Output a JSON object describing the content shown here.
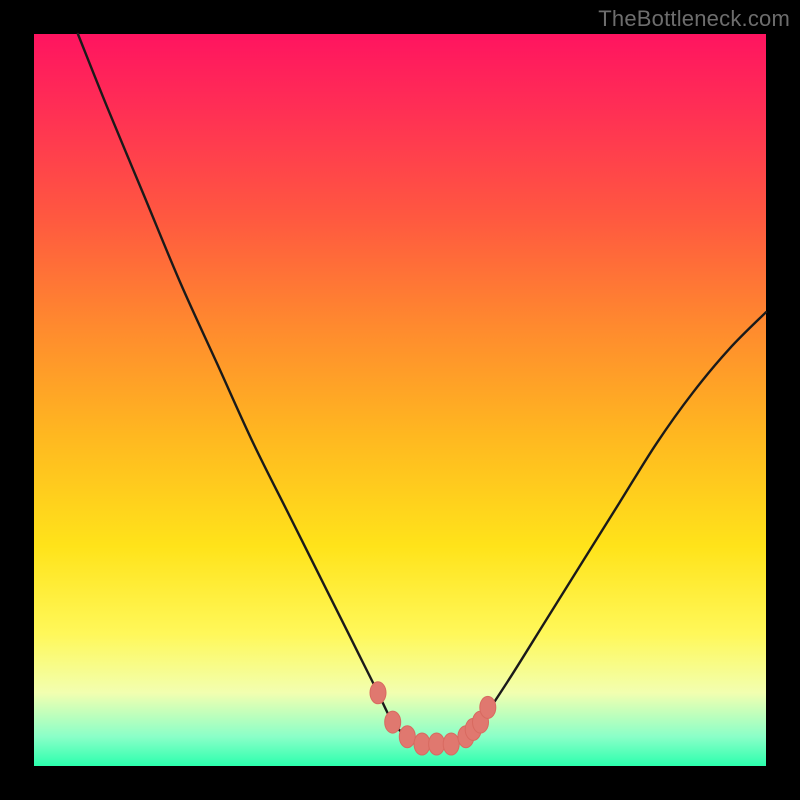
{
  "watermark": "TheBottleneck.com",
  "colors": {
    "frame": "#000000",
    "curve_stroke": "#1a1a1a",
    "marker_fill": "#e0786f",
    "marker_stroke": "#d86a60",
    "gradient_top": "#ff1460",
    "gradient_mid": "#ffe31a",
    "gradient_bottom": "#2bffad"
  },
  "chart_data": {
    "type": "line",
    "title": "",
    "xlabel": "",
    "ylabel": "",
    "xlim": [
      0,
      100
    ],
    "ylim": [
      0,
      100
    ],
    "series": [
      {
        "name": "bottleneck-curve",
        "x": [
          6,
          10,
          15,
          20,
          25,
          30,
          35,
          40,
          43,
          45,
          47,
          49,
          51,
          53,
          55,
          57,
          59,
          61,
          65,
          70,
          75,
          80,
          85,
          90,
          95,
          100
        ],
        "y": [
          100,
          90,
          78,
          66,
          55,
          44,
          34,
          24,
          18,
          14,
          10,
          6,
          4,
          3,
          3,
          3,
          4,
          6,
          12,
          20,
          28,
          36,
          44,
          51,
          57,
          62
        ]
      }
    ],
    "markers": {
      "name": "highlight-points",
      "x": [
        47,
        49,
        51,
        53,
        55,
        57,
        59,
        60,
        61,
        62
      ],
      "y": [
        10,
        6,
        4,
        3,
        3,
        3,
        4,
        5,
        6,
        8
      ]
    }
  }
}
